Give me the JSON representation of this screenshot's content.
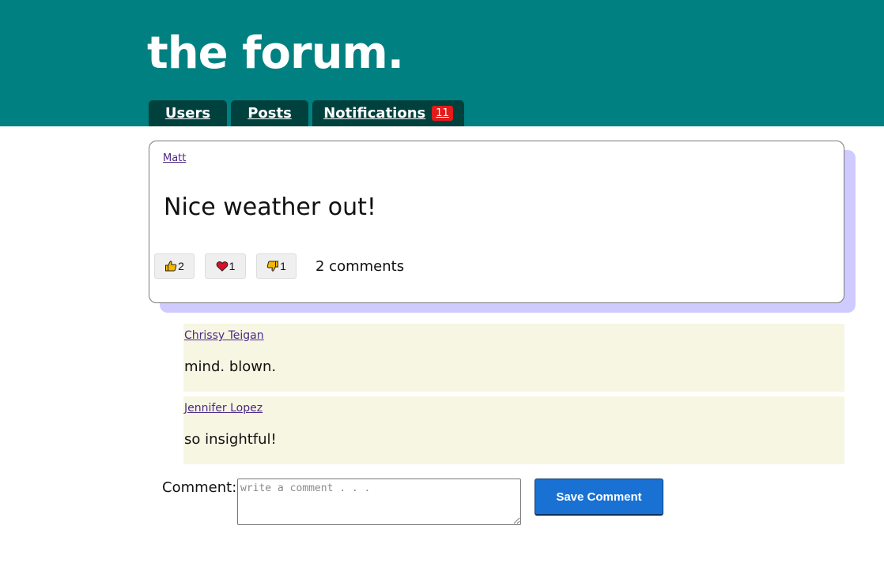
{
  "site": {
    "title": "the forum."
  },
  "nav": {
    "users_label": "Users",
    "posts_label": "Posts",
    "notifications_label": "Notifications",
    "notifications_count": "11"
  },
  "post": {
    "author": "Matt",
    "body": "Nice weather out!",
    "reactions": {
      "like_count": "2",
      "love_count": "1",
      "dislike_count": "1"
    },
    "comments_count_label": "2 comments"
  },
  "comments": [
    {
      "author": "Chrissy Teigan",
      "text": "mind. blown."
    },
    {
      "author": "Jennifer Lopez",
      "text": "so insightful!"
    }
  ],
  "comment_form": {
    "label": "Comment:",
    "placeholder": "write a comment . . .",
    "value": "",
    "save_label": "Save Comment"
  },
  "colors": {
    "header_bg": "#008080",
    "nav_tab_bg": "#00413e",
    "badge_bg": "#e21b1b",
    "card_shadow": "#cfcbff",
    "comment_bg": "#f7f6e3",
    "button_bg": "#1971d4",
    "link": "#4b2a86"
  },
  "icons": {
    "like": "thumbs-up-icon",
    "love": "heart-icon",
    "dislike": "thumbs-down-icon"
  }
}
